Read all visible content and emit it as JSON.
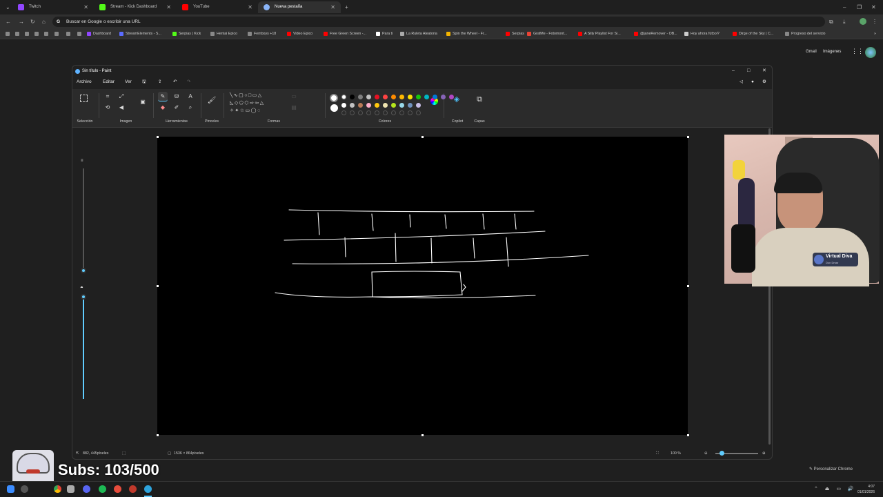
{
  "browser": {
    "tabs": [
      {
        "label": "Twitch",
        "color": "#9146ff"
      },
      {
        "label": "Stream - Kick Dashboard",
        "color": "#53fc18"
      },
      {
        "label": "YouTube",
        "color": "#ff0000"
      },
      {
        "label": "Nueva pestaña",
        "color": "#8ab4f8"
      }
    ],
    "address_placeholder": "Buscar en Google o escribir una URL",
    "bookmarks": [
      {
        "label": "Dashboard",
        "color": "#9146ff"
      },
      {
        "label": "StreamElements - S...",
        "color": "#5b6cff"
      },
      {
        "label": "Serpias | Kick",
        "color": "#53fc18"
      },
      {
        "label": "Hentai Epico",
        "color": "#888888"
      },
      {
        "label": "Femboys +18",
        "color": "#888888"
      },
      {
        "label": "Video Epico",
        "color": "#ff0000"
      },
      {
        "label": "Free Green Screen -...",
        "color": "#ff0000"
      },
      {
        "label": "Para ti",
        "color": "#ffffff"
      },
      {
        "label": "La Ruleta Aleatoria",
        "color": "#aaaaaa"
      },
      {
        "label": "Spin the Wheel - Fr...",
        "color": "#f4b400"
      },
      {
        "label": "Serpias",
        "color": "#ff0000"
      },
      {
        "label": "GrafMe - Fotomont...",
        "color": "#ea4335"
      },
      {
        "label": "A Silly Playlist For Si...",
        "color": "#ff0000"
      },
      {
        "label": "@janeRemover - OB...",
        "color": "#ff0000"
      },
      {
        "label": "Hoy ahora fútbol?",
        "color": "#cccccc"
      },
      {
        "label": "Dirge of the Sky | C...",
        "color": "#ff0000"
      },
      {
        "label": "Progreso del servicio",
        "color": "#888888"
      }
    ],
    "google_links": {
      "gmail": "Gmail",
      "images": "Imágenes"
    },
    "personalize": "Personalizar Chrome"
  },
  "paint": {
    "title": "Sin título - Paint",
    "menu": [
      "Archivo",
      "Editar",
      "Ver"
    ],
    "ribbon_groups": [
      "Selección",
      "Imagen",
      "Herramientas",
      "Pinceles",
      "Formas",
      "Colores",
      "Copilot",
      "Capas"
    ],
    "palette_row1": [
      "#ffffff",
      "#000000",
      "#7f7f7f",
      "#c3c3c3",
      "#e81123",
      "#ff4343",
      "#ff8c00",
      "#ffb900",
      "#fce100",
      "#16c60c",
      "#00b7c3",
      "#0078d7",
      "#8764b8",
      "#b146c2"
    ],
    "palette_row2": [
      "#ffffff",
      "#c3c3c3",
      "#b97a57",
      "#ffaec9",
      "#ffc90e",
      "#efe4b0",
      "#b5e61d",
      "#99d9ea",
      "#7092be",
      "#c8bfe7"
    ],
    "status": {
      "cursor_pos": "882, 445píxeles",
      "canvas_size": "1536 × 864píxeles",
      "zoom": "100 %"
    }
  },
  "overlay": {
    "subs": "Subs: 103/500",
    "webcam_badge": "Virtual Diva",
    "webcam_badge_sub": "Don Dmar"
  },
  "taskbar": {
    "time": "4:07",
    "date": "01/01/2026"
  }
}
